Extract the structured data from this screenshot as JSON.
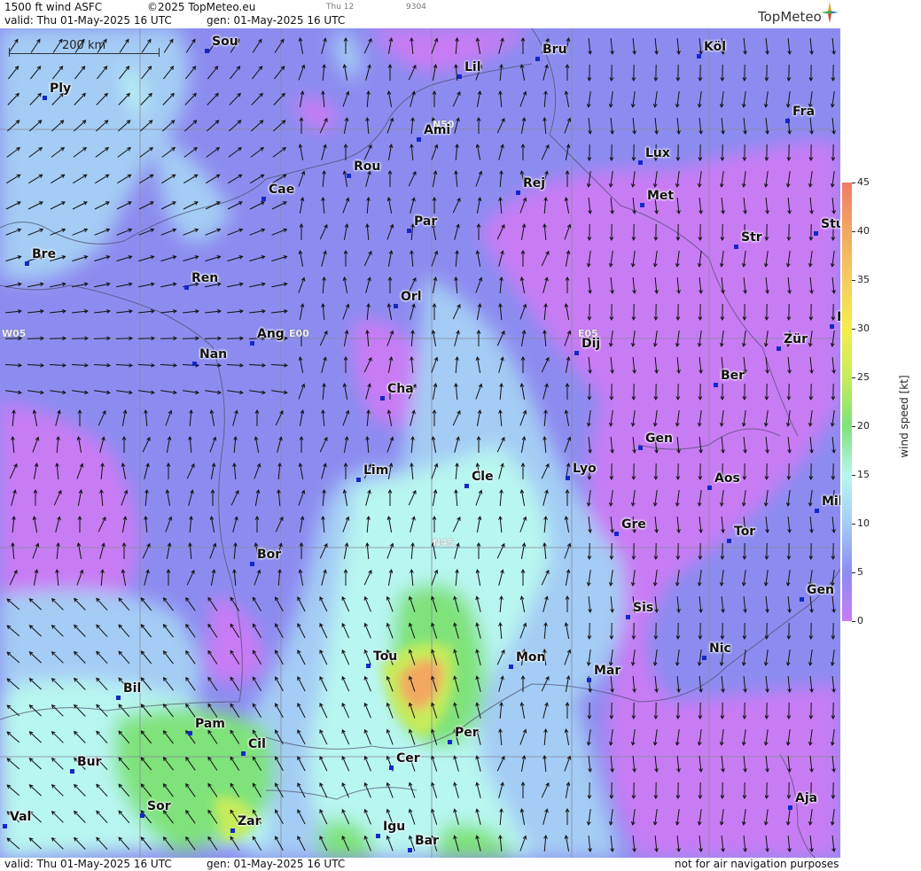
{
  "header": {
    "title": "1500 ft wind ASFC",
    "copyright": "©2025 TopMeteo.eu",
    "valid": "valid:  Thu  01-May-2025  16 UTC",
    "gen": "gen: 01-May-2025 16 UTC",
    "small_1": "Thu 12",
    "small_2": "9304"
  },
  "footer": {
    "valid": "valid:  Thu  01-May-2025  16 UTC",
    "gen": "gen: 01-May-2025 16 UTC",
    "disclaimer": "not for air navigation purposes"
  },
  "logo": {
    "text": "TopMeteo",
    "icon": "compass-star-icon"
  },
  "scale_bar": {
    "label": "200 km"
  },
  "grid_labels": [
    "N50",
    "N45",
    "W05",
    "E00",
    "E05"
  ],
  "cities": [
    {
      "name": "Sou"
    },
    {
      "name": "Ply"
    },
    {
      "name": "Lil"
    },
    {
      "name": "Bru"
    },
    {
      "name": "Köl"
    },
    {
      "name": "Ami"
    },
    {
      "name": "Fra"
    },
    {
      "name": "Rou"
    },
    {
      "name": "Lux"
    },
    {
      "name": "Cae"
    },
    {
      "name": "Rej"
    },
    {
      "name": "Met"
    },
    {
      "name": "Par"
    },
    {
      "name": "Stu"
    },
    {
      "name": "Bre"
    },
    {
      "name": "Str"
    },
    {
      "name": "Ren"
    },
    {
      "name": "Orl"
    },
    {
      "name": "Ang"
    },
    {
      "name": "Dij"
    },
    {
      "name": "Zür"
    },
    {
      "name": "Nan"
    },
    {
      "name": "Ber"
    },
    {
      "name": "Cha"
    },
    {
      "name": "Gen"
    },
    {
      "name": "Lim"
    },
    {
      "name": "Cle"
    },
    {
      "name": "Lyo"
    },
    {
      "name": "Aos"
    },
    {
      "name": "Mil"
    },
    {
      "name": "Gre"
    },
    {
      "name": "Tor"
    },
    {
      "name": "Bor"
    },
    {
      "name": "Gen"
    },
    {
      "name": "Sis"
    },
    {
      "name": "Nic"
    },
    {
      "name": "Tou"
    },
    {
      "name": "Mon"
    },
    {
      "name": "Mar"
    },
    {
      "name": "Bil"
    },
    {
      "name": "Pam"
    },
    {
      "name": "Per"
    },
    {
      "name": "Cil"
    },
    {
      "name": "Cer"
    },
    {
      "name": "Bur"
    },
    {
      "name": "Sor"
    },
    {
      "name": "Aja"
    },
    {
      "name": "Zar"
    },
    {
      "name": "Val"
    },
    {
      "name": "Igu"
    },
    {
      "name": "Bar"
    },
    {
      "name": "F"
    }
  ],
  "legend": {
    "unit": "wind speed [kt]",
    "ticks": [
      "45",
      "40",
      "35",
      "30",
      "25",
      "20",
      "15",
      "10",
      "5",
      "0"
    ],
    "colors": [
      "#f07a6a",
      "#f2a860",
      "#f5cc5c",
      "#f3ee4a",
      "#c6ec5a",
      "#7fe27a",
      "#b8f6f0",
      "#a4ccf4",
      "#8c8cf0",
      "#c87cf4"
    ]
  }
}
